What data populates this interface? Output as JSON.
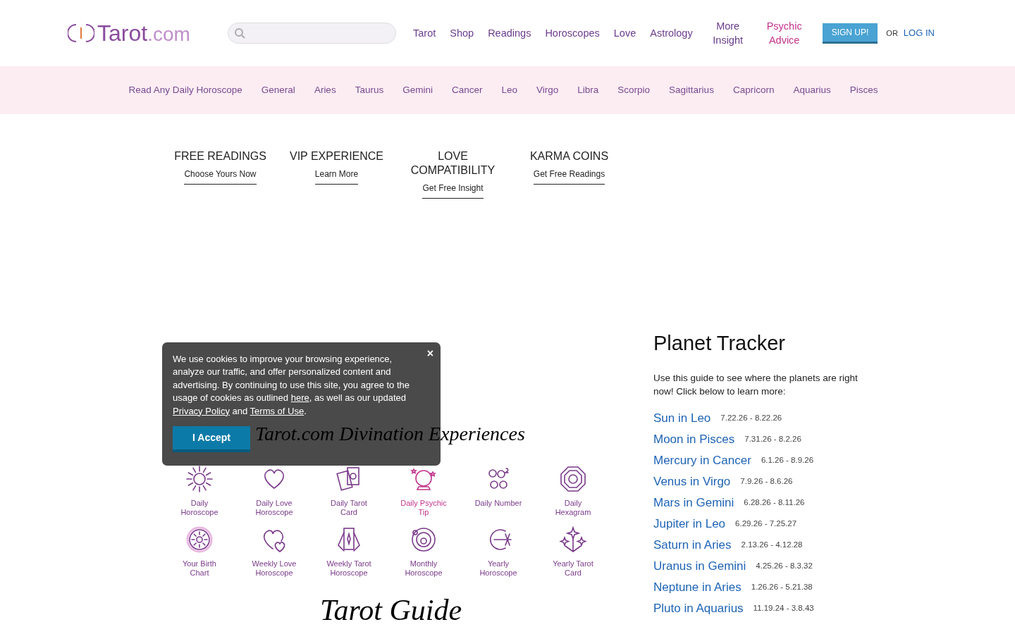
{
  "header": {
    "logo": {
      "word": "Tarot",
      "suffix": ".com"
    },
    "nav": [
      {
        "label": "Tarot",
        "color": "#6b3d8c"
      },
      {
        "label": "Shop",
        "color": "#6b3d8c"
      },
      {
        "label": "Readings",
        "color": "#6b3d8c"
      },
      {
        "label": "Horoscopes",
        "color": "#6b3d8c"
      },
      {
        "label": "Love",
        "color": "#6b3d8c"
      },
      {
        "label": "Astrology",
        "color": "#6b3d8c"
      },
      {
        "label": "More Insight",
        "color": "#6b3d8c"
      },
      {
        "label": "Psychic Advice",
        "color": "#c2338c"
      }
    ],
    "signup": "SIGN UP!",
    "or": "OR",
    "login": "LOG IN"
  },
  "subnav": [
    "Read Any Daily Horoscope",
    "General",
    "Aries",
    "Taurus",
    "Gemini",
    "Cancer",
    "Leo",
    "Virgo",
    "Libra",
    "Scorpio",
    "Sagittarius",
    "Capricorn",
    "Aquarius",
    "Pisces"
  ],
  "promos": [
    {
      "title": "FREE READINGS",
      "link": "Choose Yours Now"
    },
    {
      "title": "VIP EXPERIENCE",
      "link": "Learn More"
    },
    {
      "title": "LOVE COMPATIBILITY",
      "link": "Get Free Insight"
    },
    {
      "title": "KARMA COINS",
      "link": "Get Free Readings"
    }
  ],
  "experiences": {
    "title": "Tarot.com Divination Experiences",
    "items": [
      {
        "kind": "sun",
        "label": "Daily Horoscope",
        "color": "#7a3a8a"
      },
      {
        "kind": "heart",
        "label": "Daily Love Horoscope",
        "color": "#7a3a8a"
      },
      {
        "kind": "cards",
        "label": "Daily Tarot Card",
        "color": "#7a3a8a"
      },
      {
        "kind": "crystal-ball",
        "label": "Daily Psychic Tip",
        "color": "#c2338c"
      },
      {
        "kind": "numbers",
        "label": "Daily Number",
        "color": "#7a3a8a"
      },
      {
        "kind": "octagon",
        "label": "Daily Hexagram",
        "color": "#7a3a8a"
      },
      {
        "kind": "wheel",
        "label": "Your Birth Chart",
        "color": "#7a3a8a"
      },
      {
        "kind": "hearts",
        "label": "Weekly Love Horoscope",
        "color": "#7a3a8a"
      },
      {
        "kind": "fan",
        "label": "Weekly Tarot Horoscope",
        "color": "#7a3a8a"
      },
      {
        "kind": "orbit",
        "label": "Monthly Horoscope",
        "color": "#7a3a8a"
      },
      {
        "kind": "burst",
        "label": "Yearly Horoscope",
        "color": "#7a3a8a"
      },
      {
        "kind": "sparkles",
        "label": "Yearly Tarot Card",
        "color": "#7a3a8a"
      }
    ]
  },
  "guide": {
    "title": "Tarot Guide"
  },
  "cookie": {
    "text": "We use cookies to improve your browsing experience, analyze our traffic, and offer personalized content and advertising. By continuing to use this site, you agree to the usage of cookies as outlined ",
    "link1": "here",
    "mid": ", as well as our updated ",
    "link2": "Privacy Policy",
    "and": " and ",
    "link3": "Terms of Use",
    "end": ".",
    "close": "×",
    "accept": "I Accept"
  },
  "planet_tracker": {
    "title": "Planet Tracker",
    "intro": "Use this guide to see where the planets are right now! Click below to learn more:",
    "planets": [
      {
        "name": "Sun in Leo",
        "dates": "7.22.26 - 8.22.26"
      },
      {
        "name": "Moon in Pisces",
        "dates": "7.31.26 - 8.2.26"
      },
      {
        "name": "Mercury in Cancer",
        "dates": "6.1.26 - 8.9.26"
      },
      {
        "name": "Venus in Virgo",
        "dates": "7.9.26 - 8.6.26"
      },
      {
        "name": "Mars in Gemini",
        "dates": "6.28.26 - 8.11.26"
      },
      {
        "name": "Jupiter in Leo",
        "dates": "6.29.26 - 7.25.27"
      },
      {
        "name": "Saturn in Aries",
        "dates": "2.13.26 - 4.12.28"
      },
      {
        "name": "Uranus in Gemini",
        "dates": "4.25.26 - 8.3.32"
      },
      {
        "name": "Neptune in Aries",
        "dates": "1.26.26 - 5.21.38"
      },
      {
        "name": "Pluto in Aquarius",
        "dates": "11.19.24 - 3.8.43"
      }
    ]
  }
}
